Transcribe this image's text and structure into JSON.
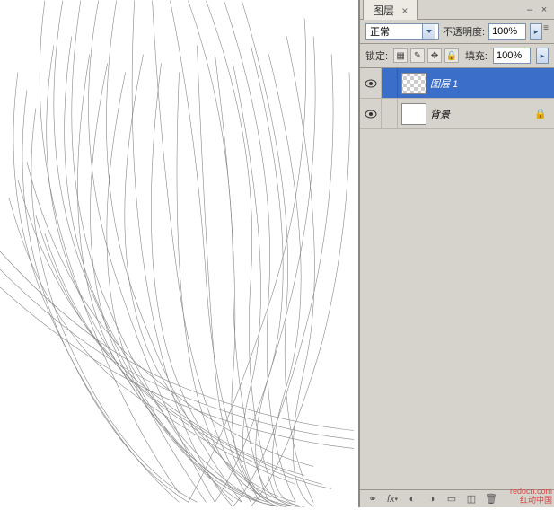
{
  "panel": {
    "title": "图层",
    "blend_mode": "正常",
    "opacity_label": "不透明度:",
    "opacity_value": "100%",
    "lock_label": "锁定:",
    "fill_label": "填充:",
    "fill_value": "100%"
  },
  "layers": [
    {
      "name": "图层 1",
      "visible": true,
      "selected": true,
      "locked": false,
      "transparent": true
    },
    {
      "name": "背景",
      "visible": true,
      "selected": false,
      "locked": true,
      "transparent": false
    }
  ],
  "watermark": {
    "line1": "redocn.com",
    "line2": "红动中国"
  }
}
